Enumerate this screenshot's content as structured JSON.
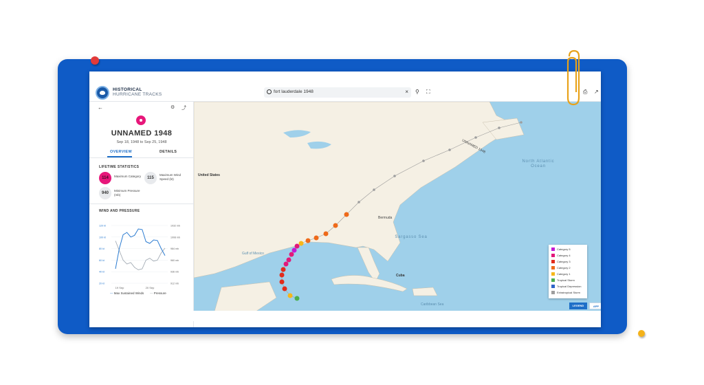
{
  "header": {
    "brand_line1": "HISTORICAL",
    "brand_line2": "HURRICANE TRACKS",
    "search_value": "fort lauderdale 1948",
    "clear_icon": "close-icon",
    "icons": [
      "search-icon",
      "location-pin-icon",
      "fullscreen-icon",
      "print-icon",
      "share-icon"
    ]
  },
  "sidebar": {
    "storm_name": "UNNAMED 1948",
    "storm_dates": "Sep 18, 1948 to Sep 25, 1948",
    "tabs": [
      {
        "label": "OVERVIEW",
        "active": true
      },
      {
        "label": "DETAILS",
        "active": false
      }
    ],
    "lifetime_title": "LIFETIME STATISTICS",
    "stats": [
      {
        "value": "114",
        "label": "Maximum Category",
        "color": "#e7177a"
      },
      {
        "value": "115",
        "label": "Maximum Wind Speed (kt)",
        "color": "#e8eaed"
      },
      {
        "value": "940",
        "label": "Minimum Pressure (mb)",
        "color": "#e8eaed"
      }
    ],
    "wind_pressure_title": "WIND AND PRESSURE",
    "left_ticks": [
      "120 kt",
      "100 kt",
      "80 kt",
      "60 kt",
      "40 kt",
      "20 kt"
    ],
    "right_ticks": [
      "1032 mb",
      "1008 mb",
      "984 mb",
      "960 mb",
      "936 mb",
      "912 mb"
    ],
    "x_ticks": [
      "19 Sep",
      "20 Sep"
    ],
    "legend_wind": "Max Sustained Winds",
    "legend_pressure": "Pressure"
  },
  "chart_data": {
    "type": "line",
    "series": [
      {
        "name": "Max Sustained Winds",
        "values": [
          45,
          80,
          104,
          108,
          100,
          103,
          114,
          113,
          92,
          89,
          95,
          94,
          80,
          68
        ]
      },
      {
        "name": "Pressure",
        "values": [
          1000,
          980,
          960,
          952,
          955,
          945,
          940,
          942,
          960,
          964,
          958,
          960,
          975,
          985
        ]
      }
    ],
    "xticks": [
      "19 Sep",
      "20 Sep"
    ],
    "ylim_left": [
      20,
      120
    ],
    "ylim_right": [
      912,
      1032
    ]
  },
  "map": {
    "labels": [
      "United States",
      "Gulf of Mexico",
      "Cuba",
      "Bermuda",
      "UNNAMED 1948",
      "Caribbean Sea"
    ],
    "ocean_north": "North Atlantic Ocean",
    "ocean_sargasso": "Sargasso Sea",
    "legend": [
      {
        "label": "Category 5",
        "color": "#c41ad4"
      },
      {
        "label": "Category 4",
        "color": "#e2187a"
      },
      {
        "label": "Category 3",
        "color": "#e12c1c"
      },
      {
        "label": "Category 2",
        "color": "#ee6a1a"
      },
      {
        "label": "Category 1",
        "color": "#f6b71a"
      },
      {
        "label": "Tropical Storm",
        "color": "#4caf50"
      },
      {
        "label": "Tropical Depression",
        "color": "#2f65c8"
      },
      {
        "label": "Extratropical Storm",
        "color": "#9e9e9e"
      }
    ],
    "legend_button": "LEGEND",
    "second_button": "APP"
  }
}
